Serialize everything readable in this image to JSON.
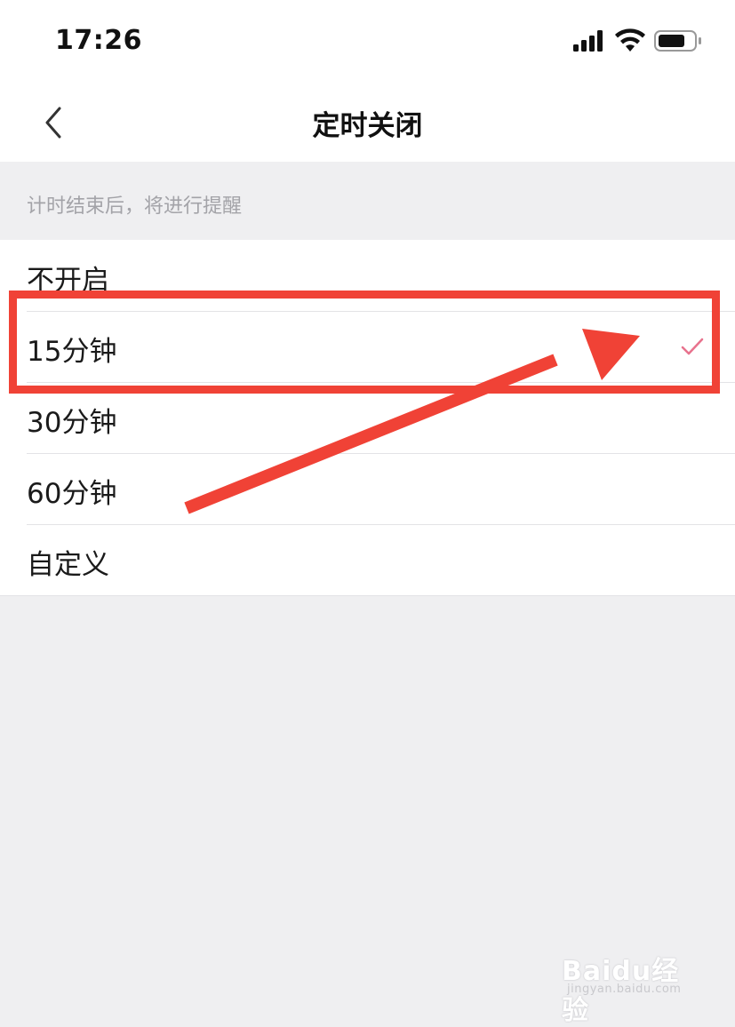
{
  "status_bar": {
    "time": "17:26",
    "icons": [
      "signal-icon",
      "wifi-icon",
      "battery-icon"
    ]
  },
  "nav": {
    "back_icon": "chevron-left-icon",
    "title": "定时关闭"
  },
  "hint": "计时结束后，将进行提醒",
  "options": [
    {
      "label": "不开启",
      "selected": false
    },
    {
      "label": "15分钟",
      "selected": true
    },
    {
      "label": "30分钟",
      "selected": false
    },
    {
      "label": "60分钟",
      "selected": false
    },
    {
      "label": "自定义",
      "selected": false
    }
  ],
  "colors": {
    "accent_check": "#e8728d",
    "annotation_red": "#f04236",
    "background": "#efeff1"
  },
  "watermark": {
    "main": "Baidu经验",
    "sub": "jingyan.baidu.com"
  }
}
